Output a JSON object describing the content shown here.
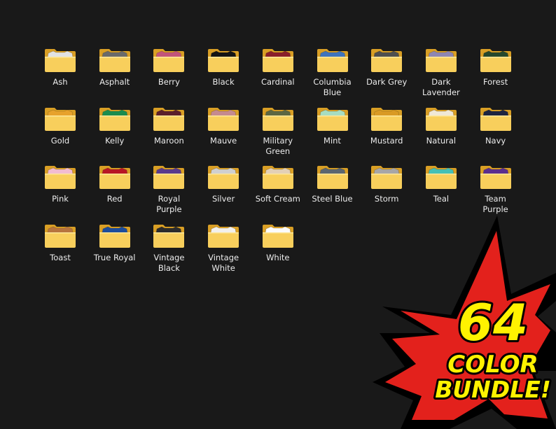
{
  "folders": [
    {
      "label": "Ash",
      "shirt": "#e2e2e2"
    },
    {
      "label": "Asphalt",
      "shirt": "#6a6a6a"
    },
    {
      "label": "Berry",
      "shirt": "#c2547a"
    },
    {
      "label": "Black",
      "shirt": "#141414"
    },
    {
      "label": "Cardinal",
      "shirt": "#8a1e2a"
    },
    {
      "label": "Columbia\nBlue",
      "shirt": "#3f74bd"
    },
    {
      "label": "Dark Grey",
      "shirt": "#4f4f4f"
    },
    {
      "label": "Dark\nLavender",
      "shirt": "#8e86b2"
    },
    {
      "label": "Forest",
      "shirt": "#26482c"
    },
    {
      "label": "Gold",
      "shirt": "#e7a22c"
    },
    {
      "label": "Kelly",
      "shirt": "#1b8c4e"
    },
    {
      "label": "Maroon",
      "shirt": "#5c1f2a"
    },
    {
      "label": "Mauve",
      "shirt": "#c58a8f"
    },
    {
      "label": "Military\nGreen",
      "shirt": "#5d6742"
    },
    {
      "label": "Mint",
      "shirt": "#a7ddc1"
    },
    {
      "label": "Mustard",
      "shirt": "#d99a24"
    },
    {
      "label": "Natural",
      "shirt": "#f0e8d6"
    },
    {
      "label": "Navy",
      "shirt": "#1d2440"
    },
    {
      "label": "Pink",
      "shirt": "#f2bcd0"
    },
    {
      "label": "Red",
      "shirt": "#b81625"
    },
    {
      "label": "Royal\nPurple",
      "shirt": "#5a3a8c"
    },
    {
      "label": "Silver",
      "shirt": "#cfcfcf"
    },
    {
      "label": "Soft Cream",
      "shirt": "#e3d0b6"
    },
    {
      "label": "Steel Blue",
      "shirt": "#5b6670"
    },
    {
      "label": "Storm",
      "shirt": "#a8a6a6"
    },
    {
      "label": "Teal",
      "shirt": "#45c0b6"
    },
    {
      "label": "Team\nPurple",
      "shirt": "#5a2e8e"
    },
    {
      "label": "Toast",
      "shirt": "#b7743e"
    },
    {
      "label": "True Royal",
      "shirt": "#1c4c9b"
    },
    {
      "label": "Vintage\nBlack",
      "shirt": "#2c2c2c"
    },
    {
      "label": "Vintage\nWhite",
      "shirt": "#f2f0ec"
    },
    {
      "label": "White",
      "shirt": "#fbfbfb"
    }
  ],
  "promo": {
    "line1": "64",
    "line2": "COLOR",
    "line3": "BUNDLE!"
  },
  "colors": {
    "background": "#191919",
    "folder_front": "#f8cf5c",
    "folder_back": "#d99f25",
    "burst_fill": "#e3211c",
    "text_yellow": "#fff200"
  }
}
